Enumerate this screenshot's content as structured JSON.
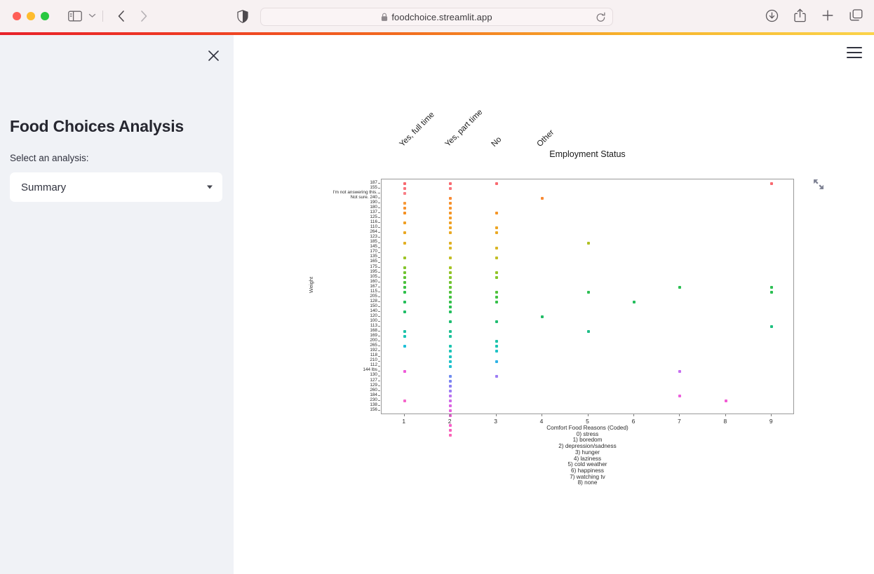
{
  "browser": {
    "url": "foodchoice.streamlit.app",
    "lock_icon": "lock-icon",
    "reload_icon": "reload-icon",
    "shield_icon": "shield-icon",
    "sidebar_toggle_icon": "sidebar-toggle-icon",
    "chevron_icon": "chevron-down-icon",
    "back_icon": "chevron-left-icon",
    "forward_icon": "chevron-right-icon",
    "downloads_icon": "downloads-icon",
    "share_icon": "share-icon",
    "new_tab_icon": "plus-icon",
    "tab_overview_icon": "tab-overview-icon"
  },
  "sidebar": {
    "title": "Food Choices Analysis",
    "select_label": "Select an analysis:",
    "selected_analysis": "Summary",
    "close_icon": "close-icon",
    "caret_icon": "chevron-down-icon"
  },
  "main": {
    "menu_icon": "hamburger-menu-icon",
    "fullscreen_icon": "fullscreen-expand-icon"
  },
  "chart_data": {
    "type": "scatter",
    "title": "Employment Status",
    "xlabel": "Comfort Food Reasons (Coded)",
    "ylabel": "Weight",
    "grid": false,
    "xlim": [
      0.5,
      9.5
    ],
    "x_ticks": [
      "1",
      "2",
      "3",
      "4",
      "5",
      "6",
      "7",
      "8",
      "9"
    ],
    "top_axis_label": "Employment Status",
    "top_ticks": [
      {
        "label": "Yes, full time",
        "x": 1
      },
      {
        "label": "Yes, part time",
        "x": 2
      },
      {
        "label": "No",
        "x": 3
      },
      {
        "label": "Other",
        "x": 4
      }
    ],
    "legend_position": "below-axis",
    "legend_title": "Comfort Food Reasons (Coded)",
    "legend_entries": [
      "0) stress",
      "1) boredom",
      "2) depression/sadness",
      "3) hunger",
      "4) laziness",
      "5) cold weather",
      "6) happiness",
      "7) watching tv",
      "8) none"
    ],
    "y_tick_labels": [
      "187",
      "155",
      "I'm not answering this.",
      "Not sure. 240",
      "190",
      "180",
      "137",
      "125",
      "116",
      "110",
      "264",
      "123",
      "185",
      "145",
      "170",
      "135",
      "165",
      "175",
      "195",
      "105",
      "160",
      "167",
      "115",
      "205",
      "128",
      "150",
      "140",
      "120",
      "100",
      "113",
      "168",
      "169",
      "200",
      "265",
      "192",
      "118",
      "210",
      "112",
      "144 lbs",
      "130",
      "127",
      "129",
      "260",
      "184",
      "230",
      "138",
      "156"
    ],
    "colormap": "rainbow",
    "points": [
      {
        "x": 1,
        "yi": 0,
        "c": "#f8696f"
      },
      {
        "x": 1,
        "yi": 1,
        "c": "#f8737a"
      },
      {
        "x": 1,
        "yi": 2,
        "c": "#f97f87"
      },
      {
        "x": 1,
        "yi": 4,
        "c": "#f79a3a"
      },
      {
        "x": 1,
        "yi": 5,
        "c": "#f6922d"
      },
      {
        "x": 1,
        "yi": 6,
        "c": "#f59022"
      },
      {
        "x": 1,
        "yi": 8,
        "c": "#f0a024"
      },
      {
        "x": 1,
        "yi": 10,
        "c": "#eaa823"
      },
      {
        "x": 1,
        "yi": 12,
        "c": "#e2b024"
      },
      {
        "x": 1,
        "yi": 15,
        "c": "#9ec424"
      },
      {
        "x": 1,
        "yi": 17,
        "c": "#84c52c"
      },
      {
        "x": 1,
        "yi": 18,
        "c": "#72c42f"
      },
      {
        "x": 1,
        "yi": 19,
        "c": "#5fc336"
      },
      {
        "x": 1,
        "yi": 20,
        "c": "#4cc23c"
      },
      {
        "x": 1,
        "yi": 21,
        "c": "#3ec143"
      },
      {
        "x": 1,
        "yi": 22,
        "c": "#2fc04b"
      },
      {
        "x": 1,
        "yi": 24,
        "c": "#25be5a"
      },
      {
        "x": 1,
        "yi": 26,
        "c": "#20bd68"
      },
      {
        "x": 1,
        "yi": 30,
        "c": "#1ec2a5"
      },
      {
        "x": 1,
        "yi": 31,
        "c": "#1dc4b5"
      },
      {
        "x": 1,
        "yi": 33,
        "c": "#1fc0d8"
      },
      {
        "x": 1,
        "yi": 38,
        "c": "#ef5bd9"
      },
      {
        "x": 1,
        "yi": 44,
        "c": "#f565c9"
      },
      {
        "x": 2,
        "yi": 0,
        "c": "#f8696f"
      },
      {
        "x": 2,
        "yi": 1,
        "c": "#f8737a"
      },
      {
        "x": 2,
        "yi": 3,
        "c": "#f88a34"
      },
      {
        "x": 2,
        "yi": 4,
        "c": "#f7912c"
      },
      {
        "x": 2,
        "yi": 5,
        "c": "#f6932a"
      },
      {
        "x": 2,
        "yi": 6,
        "c": "#f59526"
      },
      {
        "x": 2,
        "yi": 7,
        "c": "#f39b25"
      },
      {
        "x": 2,
        "yi": 8,
        "c": "#f0a024"
      },
      {
        "x": 2,
        "yi": 9,
        "c": "#eda423"
      },
      {
        "x": 2,
        "yi": 10,
        "c": "#eaa823"
      },
      {
        "x": 2,
        "yi": 12,
        "c": "#e2b024"
      },
      {
        "x": 2,
        "yi": 13,
        "c": "#dab524"
      },
      {
        "x": 2,
        "yi": 15,
        "c": "#c2bd24"
      },
      {
        "x": 2,
        "yi": 17,
        "c": "#a4c324"
      },
      {
        "x": 2,
        "yi": 18,
        "c": "#93c426"
      },
      {
        "x": 2,
        "yi": 19,
        "c": "#84c52c"
      },
      {
        "x": 2,
        "yi": 20,
        "c": "#72c42f"
      },
      {
        "x": 2,
        "yi": 21,
        "c": "#63c334"
      },
      {
        "x": 2,
        "yi": 22,
        "c": "#52c23a"
      },
      {
        "x": 2,
        "yi": 23,
        "c": "#43c141"
      },
      {
        "x": 2,
        "yi": 24,
        "c": "#35c049"
      },
      {
        "x": 2,
        "yi": 25,
        "c": "#2bbf52"
      },
      {
        "x": 2,
        "yi": 26,
        "c": "#24be5d"
      },
      {
        "x": 2,
        "yi": 28,
        "c": "#1fbd71"
      },
      {
        "x": 2,
        "yi": 30,
        "c": "#1ec08f"
      },
      {
        "x": 2,
        "yi": 31,
        "c": "#1dc29d"
      },
      {
        "x": 2,
        "yi": 33,
        "c": "#1cc4b0"
      },
      {
        "x": 2,
        "yi": 34,
        "c": "#1cc4b8"
      },
      {
        "x": 2,
        "yi": 35,
        "c": "#1dc3c0"
      },
      {
        "x": 2,
        "yi": 36,
        "c": "#1ec2c8"
      },
      {
        "x": 2,
        "yi": 37,
        "c": "#1fc0d0"
      },
      {
        "x": 2,
        "yi": 39,
        "c": "#6f8cf0"
      },
      {
        "x": 2,
        "yi": 40,
        "c": "#7b84f2"
      },
      {
        "x": 2,
        "yi": 41,
        "c": "#8c7ef3"
      },
      {
        "x": 2,
        "yi": 42,
        "c": "#9d7df4"
      },
      {
        "x": 2,
        "yi": 43,
        "c": "#bd72f0"
      },
      {
        "x": 2,
        "yi": 44,
        "c": "#cf6ae8"
      },
      {
        "x": 2,
        "yi": 45,
        "c": "#dd63e2"
      },
      {
        "x": 2,
        "yi": 46,
        "c": "#e85edd"
      },
      {
        "x": 2,
        "yi": 47,
        "c": "#f059d7"
      },
      {
        "x": 2,
        "yi": 49,
        "c": "#f75cc8"
      },
      {
        "x": 2,
        "yi": 50,
        "c": "#f860be"
      },
      {
        "x": 2,
        "yi": 51,
        "c": "#f965b6"
      },
      {
        "x": 3,
        "yi": 0,
        "c": "#f8696f"
      },
      {
        "x": 3,
        "yi": 6,
        "c": "#f59526"
      },
      {
        "x": 3,
        "yi": 9,
        "c": "#eda423"
      },
      {
        "x": 3,
        "yi": 10,
        "c": "#eaa823"
      },
      {
        "x": 3,
        "yi": 13,
        "c": "#dab524"
      },
      {
        "x": 3,
        "yi": 15,
        "c": "#c2bd24"
      },
      {
        "x": 3,
        "yi": 18,
        "c": "#93c426"
      },
      {
        "x": 3,
        "yi": 19,
        "c": "#84c52c"
      },
      {
        "x": 3,
        "yi": 22,
        "c": "#52c23a"
      },
      {
        "x": 3,
        "yi": 23,
        "c": "#43c141"
      },
      {
        "x": 3,
        "yi": 24,
        "c": "#35c049"
      },
      {
        "x": 3,
        "yi": 28,
        "c": "#1fbd71"
      },
      {
        "x": 3,
        "yi": 32,
        "c": "#1cc3a8"
      },
      {
        "x": 3,
        "yi": 33,
        "c": "#1cc4b5"
      },
      {
        "x": 3,
        "yi": 34,
        "c": "#1ec2c6"
      },
      {
        "x": 3,
        "yi": 36,
        "c": "#2eb3e6"
      },
      {
        "x": 3,
        "yi": 39,
        "c": "#9d7df4"
      },
      {
        "x": 4,
        "yi": 3,
        "c": "#f88a34"
      },
      {
        "x": 4,
        "yi": 27,
        "c": "#22bc66"
      },
      {
        "x": 5,
        "yi": 12,
        "c": "#b0c024"
      },
      {
        "x": 5,
        "yi": 22,
        "c": "#2fbf55"
      },
      {
        "x": 5,
        "yi": 30,
        "c": "#1fbe88"
      },
      {
        "x": 6,
        "yi": 24,
        "c": "#24be5d"
      },
      {
        "x": 7,
        "yi": 21,
        "c": "#2bbf52"
      },
      {
        "x": 7,
        "yi": 38,
        "c": "#c76ff0"
      },
      {
        "x": 7,
        "yi": 43,
        "c": "#ed5fdc"
      },
      {
        "x": 8,
        "yi": 44,
        "c": "#f25ad4"
      },
      {
        "x": 9,
        "yi": 0,
        "c": "#f8696f"
      },
      {
        "x": 9,
        "yi": 21,
        "c": "#2fbf55"
      },
      {
        "x": 9,
        "yi": 22,
        "c": "#2bbf52"
      },
      {
        "x": 9,
        "yi": 29,
        "c": "#1fc07f"
      }
    ]
  }
}
